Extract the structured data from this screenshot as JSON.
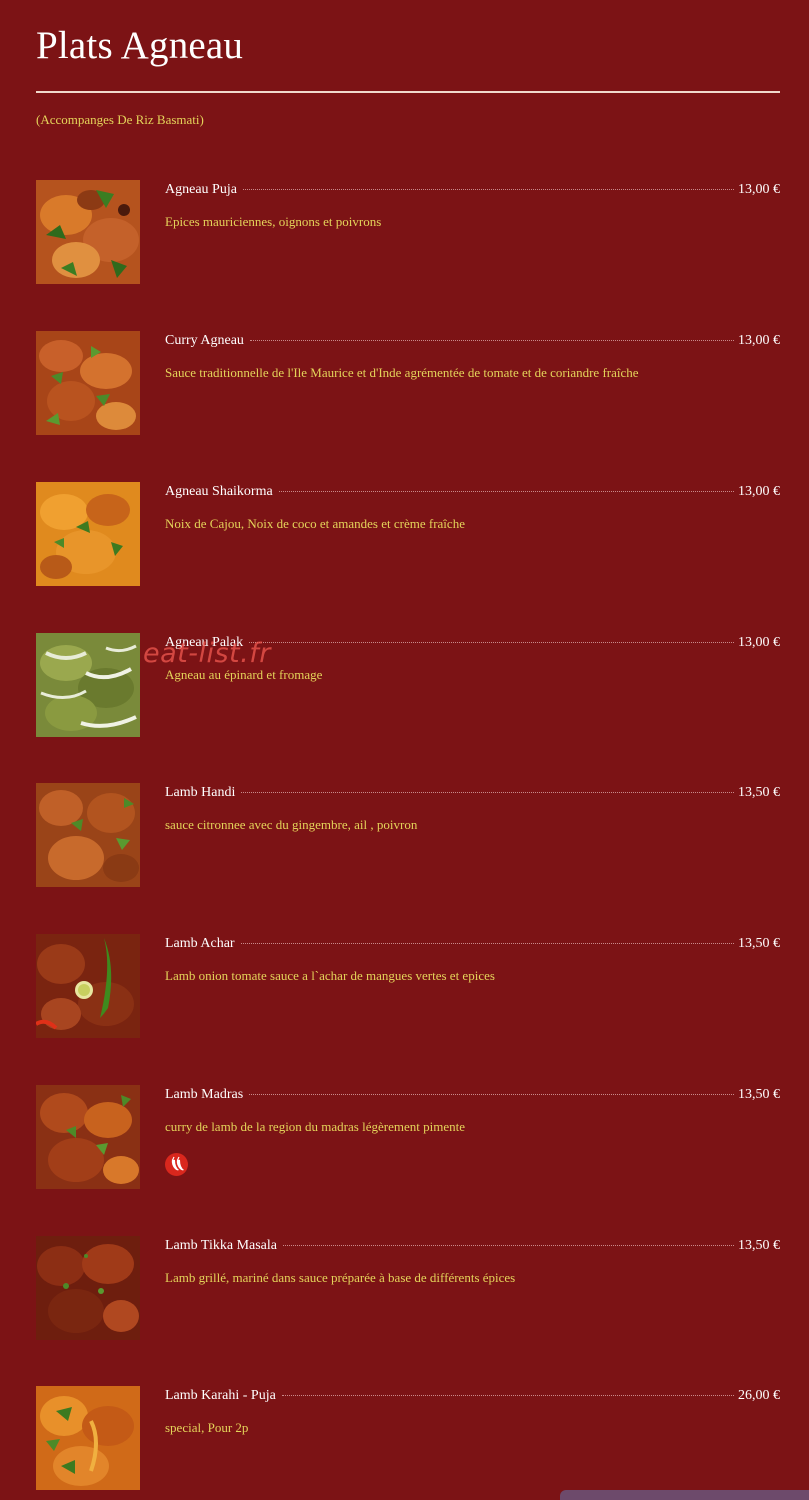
{
  "header": {
    "title": "Plats Agneau",
    "subtitle": "(Accompanges De Riz Basmati)"
  },
  "menu": {
    "items": [
      {
        "name": "Agneau Puja",
        "price": "13,00 €",
        "description": "Epices mauriciennes, oignons et poivrons"
      },
      {
        "name": "Curry Agneau",
        "price": "13,00 €",
        "description": "Sauce traditionnelle de l'Ile Maurice et d'Inde agrémentée de tomate et de coriandre fraîche"
      },
      {
        "name": "Agneau Shaikorma",
        "price": "13,00 €",
        "description": "Noix de Cajou, Noix de coco et amandes et crème fraîche"
      },
      {
        "name": "Agneau Palak",
        "price": "13,00 €",
        "description": "Agneau au épinard et fromage"
      },
      {
        "name": "Lamb Handi",
        "price": "13,50 €",
        "description": "sauce citronnee avec du gingembre, ail , poivron"
      },
      {
        "name": "Lamb Achar",
        "price": "13,50 €",
        "description": "Lamb onion tomate sauce a l`achar de mangues vertes et epices"
      },
      {
        "name": "Lamb Madras",
        "price": "13,50 €",
        "description": "curry de lamb de la region du madras légèrement pimente"
      },
      {
        "name": "Lamb Tikka Masala",
        "price": "13,50 €",
        "description": "Lamb grillé, mariné dans sauce préparée à base de différents épices"
      },
      {
        "name": "Lamb Karahi - Puja",
        "price": "26,00 €",
        "description": "special, Pour 2p"
      }
    ]
  },
  "watermark": "eat-list.fr",
  "icons": {
    "spicy": "chili-pepper-icon"
  },
  "colors": {
    "background": "#7c1315",
    "title": "#ffffff",
    "description": "#e4d35a",
    "spicy_badge": "#d9271d"
  }
}
